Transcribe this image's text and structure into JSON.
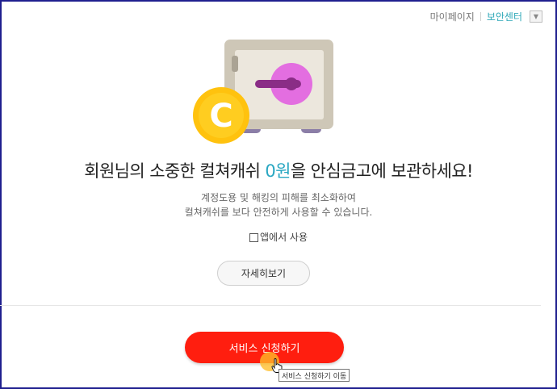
{
  "topnav": {
    "mypage": "마이페이지",
    "security_center": "보안센터",
    "dropdown_icon": "▼"
  },
  "illustration": {
    "coin_letter": "C",
    "icon": "safe-icon"
  },
  "headline": {
    "prefix": "회원님의 소중한 컬쳐캐쉬 ",
    "amount": "0원",
    "suffix": "을 안심금고에 보관하세요!"
  },
  "description": {
    "line1": "계정도용 및 해킹의 피해를 최소화하여",
    "line2": "컬쳐캐쉬를 보다 안전하게 사용할 수 있습니다."
  },
  "app_use": {
    "label": "앱에서 사용",
    "checked": false
  },
  "details_button": "자세히보기",
  "apply_button": "서비스 신청하기",
  "tooltip": "서비스 신청하기 이동",
  "colors": {
    "accent": "#29a7c2",
    "primary_button": "#ff1e0f",
    "coin": "#ffc20e",
    "safe_dial": "#e36ee0"
  }
}
